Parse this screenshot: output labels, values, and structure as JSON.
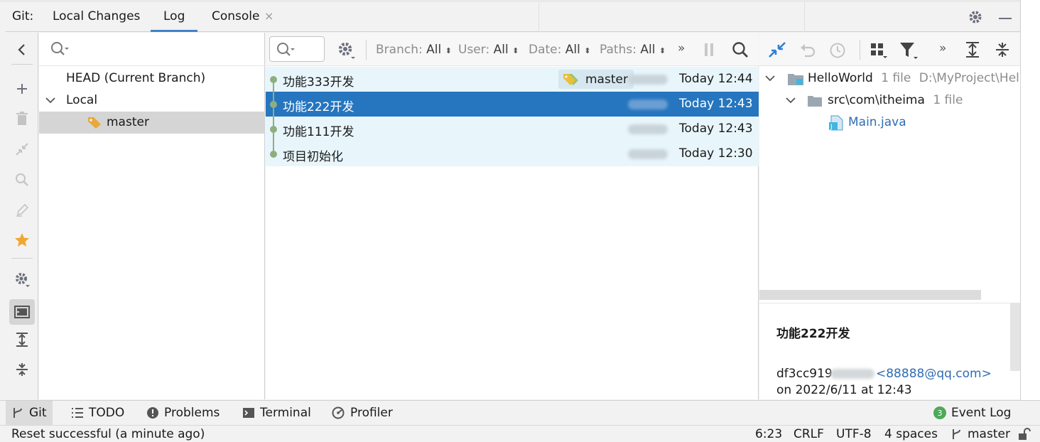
{
  "tool_window": {
    "prefix": "Git:",
    "tabs": [
      {
        "label": "Local Changes",
        "active": false
      },
      {
        "label": "Log",
        "active": true
      },
      {
        "label": "Console",
        "active": false
      }
    ],
    "close_glyph": "×"
  },
  "branches": {
    "head": "HEAD (Current Branch)",
    "local_group": "Local",
    "items": [
      {
        "label": "master",
        "selected": true
      }
    ]
  },
  "log_toolbar": {
    "filters": [
      {
        "name": "Branch:",
        "value": "All"
      },
      {
        "name": "User:",
        "value": "All"
      },
      {
        "name": "Date:",
        "value": "All"
      },
      {
        "name": "Paths:",
        "value": "All"
      }
    ],
    "more": "»"
  },
  "commits": [
    {
      "message": "功能333开发",
      "date": "Today 12:44",
      "tag": "master",
      "selected": false
    },
    {
      "message": "功能222开发",
      "date": "Today 12:43",
      "tag": "",
      "selected": true
    },
    {
      "message": "功能111开发",
      "date": "Today 12:43",
      "tag": "",
      "selected": false
    },
    {
      "message": "项目初始化",
      "date": "Today 12:30",
      "tag": "",
      "selected": false
    }
  ],
  "changes_tree": {
    "more": "»",
    "project": {
      "name": "HelloWorld",
      "count": "1 file",
      "path": "D:\\MyProject\\Hell"
    },
    "folder": {
      "name": "src\\com\\itheima",
      "count": "1 file"
    },
    "file": {
      "name": "Main.java"
    }
  },
  "details": {
    "subject": "功能222开发",
    "hash": "df3cc919",
    "email": "<88888@qq.com>",
    "date_line": "on 2022/6/11 at 12:43"
  },
  "tool_stripe": {
    "items": [
      {
        "label": "Git",
        "icon": "git-branch-icon",
        "active": true
      },
      {
        "label": "TODO",
        "icon": "list-icon",
        "active": false
      },
      {
        "label": "Problems",
        "icon": "error-icon",
        "active": false
      },
      {
        "label": "Terminal",
        "icon": "terminal-icon",
        "active": false
      },
      {
        "label": "Profiler",
        "icon": "profiler-icon",
        "active": false
      }
    ],
    "event_log": {
      "label": "Event Log",
      "badge": "3"
    }
  },
  "status_bar": {
    "message": "Reset successful (a minute ago)",
    "position": "6:23",
    "line_sep": "CRLF",
    "encoding": "UTF-8",
    "indent": "4 spaces",
    "branch": "master"
  },
  "colors": {
    "accent": "#2675bf",
    "tab_underline": "#4083c9",
    "graph": "#8fae7f",
    "link": "#2f6db4",
    "tag": "#e8a93b"
  }
}
